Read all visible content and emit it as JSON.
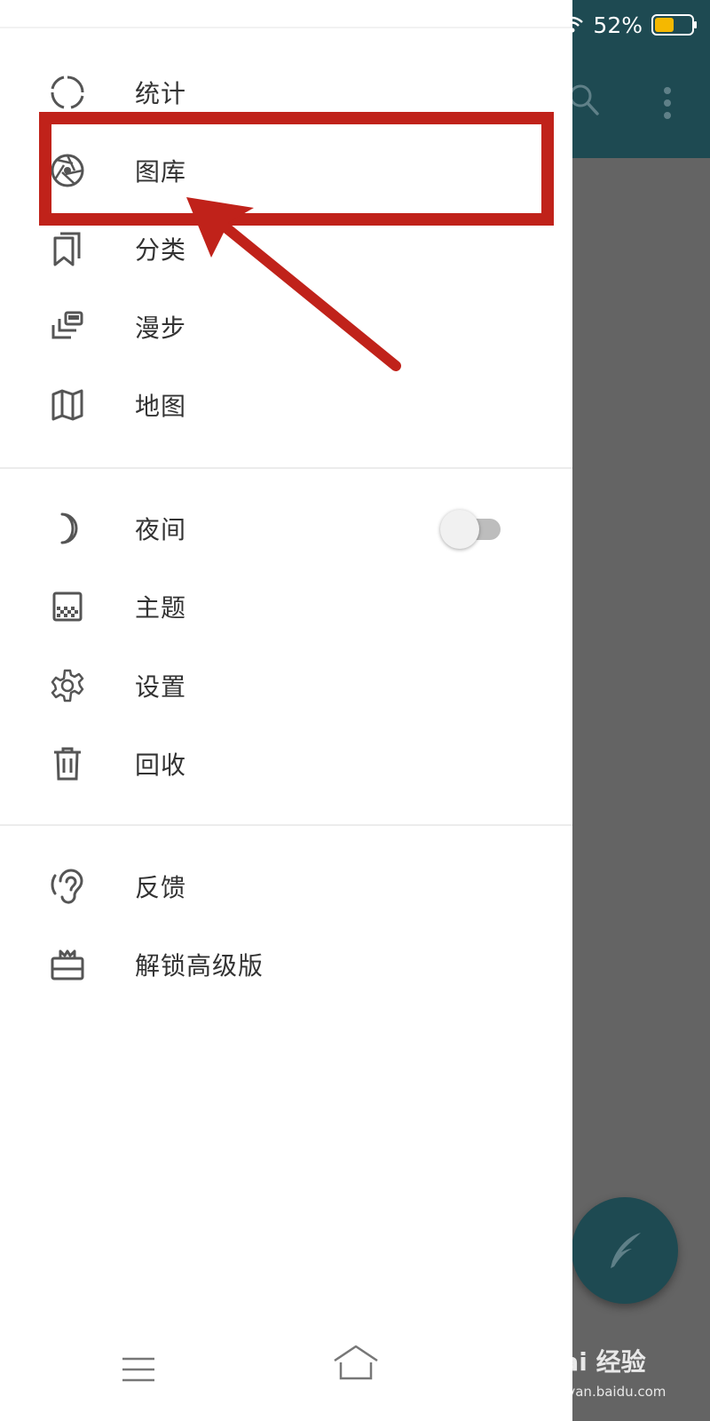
{
  "status_bar": {
    "battery_percent": "52%",
    "battery_level": 0.52,
    "battery_color": "#f5b800"
  },
  "app": {
    "toolbar_color": "#1e4a52",
    "icons": [
      "search-icon",
      "more-vertical-icon"
    ],
    "fab_icon": "feather-icon"
  },
  "drawer": {
    "section_main": [
      {
        "label": "统计",
        "icon": "circle-dashed-icon"
      },
      {
        "label": "图库",
        "icon": "aperture-icon"
      },
      {
        "label": "分类",
        "icon": "bookmark-icon"
      },
      {
        "label": "漫步",
        "icon": "cards-icon"
      },
      {
        "label": "地图",
        "icon": "map-icon"
      }
    ],
    "section_prefs": [
      {
        "label": "夜间",
        "icon": "moon-icon",
        "toggle_on": false
      },
      {
        "label": "主题",
        "icon": "theme-icon"
      },
      {
        "label": "设置",
        "icon": "gear-icon"
      },
      {
        "label": "回收",
        "icon": "trash-icon"
      }
    ],
    "section_other": [
      {
        "label": "反馈",
        "icon": "ear-icon"
      },
      {
        "label": "解锁高级版",
        "icon": "gift-icon"
      }
    ]
  },
  "annotation": {
    "highlight_color": "#c0221a",
    "highlight_target": "图库"
  },
  "watermark": {
    "brand": "Bai 经验",
    "url": "jingyan.baidu.com"
  }
}
